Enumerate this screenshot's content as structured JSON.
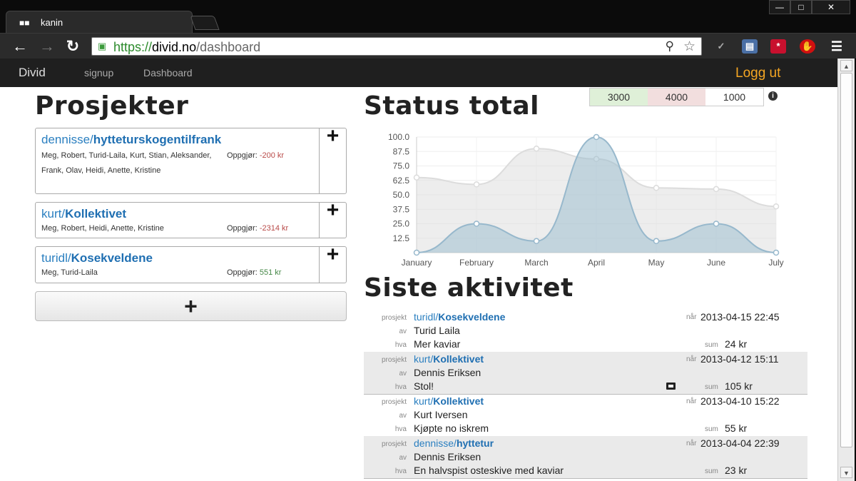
{
  "browser": {
    "tab_title": "kanin",
    "url_scheme": "https://",
    "url_host": "divid.no",
    "url_path": "/dashboard"
  },
  "nav": {
    "brand": "Divid",
    "links": [
      "signup",
      "Dashboard"
    ],
    "logout": "Logg ut"
  },
  "projects": {
    "title": "Prosjekter",
    "items": [
      {
        "owner": "dennisse/",
        "name": "hytteturskogentilfrank",
        "members": "Meg, Robert, Turid-Laila, Kurt, Stian, Aleksander, Frank, Olav, Heidi, Anette, Kristine",
        "settle_label": "Oppgjør:",
        "settle_value": "-200 kr"
      },
      {
        "owner": "kurt/",
        "name": "Kollektivet",
        "members": "Meg, Robert, Heidi, Anette, Kristine",
        "settle_label": "Oppgjør:",
        "settle_value": "-2314 kr"
      },
      {
        "owner": "turidl/",
        "name": "Kosekveldene",
        "members": "Meg, Turid-Laila",
        "settle_label": "Oppgjør:",
        "settle_value": "551 kr"
      }
    ],
    "add_symbol": "+"
  },
  "status": {
    "title": "Status total",
    "chips": [
      "3000",
      "4000",
      "1000"
    ],
    "info_icon": "info-icon"
  },
  "chart_data": {
    "type": "area",
    "categories": [
      "January",
      "February",
      "March",
      "April",
      "May",
      "June",
      "July"
    ],
    "series": [
      {
        "values": [
          65,
          59,
          90,
          81,
          56,
          55,
          40
        ],
        "color": "#dcdcdc"
      },
      {
        "values": [
          0,
          25,
          10,
          100,
          10,
          25,
          0
        ],
        "color": "#97b8cc"
      }
    ],
    "yticks": [
      "100.0",
      "87.5",
      "75.0",
      "62.5",
      "50.0",
      "37.5",
      "25.0",
      "12.5"
    ],
    "ylim": [
      0,
      100
    ],
    "grid": true
  },
  "activity": {
    "title": "Siste aktivitet",
    "labels": {
      "project": "prosjekt",
      "by": "av",
      "what": "hva",
      "when": "når",
      "sum": "sum"
    },
    "items": [
      {
        "owner": "turidl/",
        "name": "Kosekveldene",
        "by": "Turid Laila",
        "what": "Mer kaviar",
        "when": "2013-04-15 22:45",
        "sum": "24 kr",
        "image": false
      },
      {
        "owner": "kurt/",
        "name": "Kollektivet",
        "by": "Dennis Eriksen",
        "what": "Stol!",
        "when": "2013-04-12 15:11",
        "sum": "105 kr",
        "image": true
      },
      {
        "owner": "kurt/",
        "name": "Kollektivet",
        "by": "Kurt Iversen",
        "what": "Kjøpte no iskrem",
        "when": "2013-04-10 15:22",
        "sum": "55 kr",
        "image": false
      },
      {
        "owner": "dennisse/",
        "name": "hyttetur",
        "by": "Dennis Eriksen",
        "what": "En halvspist osteskive med kaviar",
        "when": "2013-04-04 22:39",
        "sum": "23 kr",
        "image": false
      }
    ]
  },
  "colors": {
    "accent": "#2a7fc0",
    "logout": "#f5a623",
    "negative": "#b94a48",
    "positive": "#468847",
    "chip_green": "#dff0d8",
    "chip_red": "#f2dede"
  }
}
